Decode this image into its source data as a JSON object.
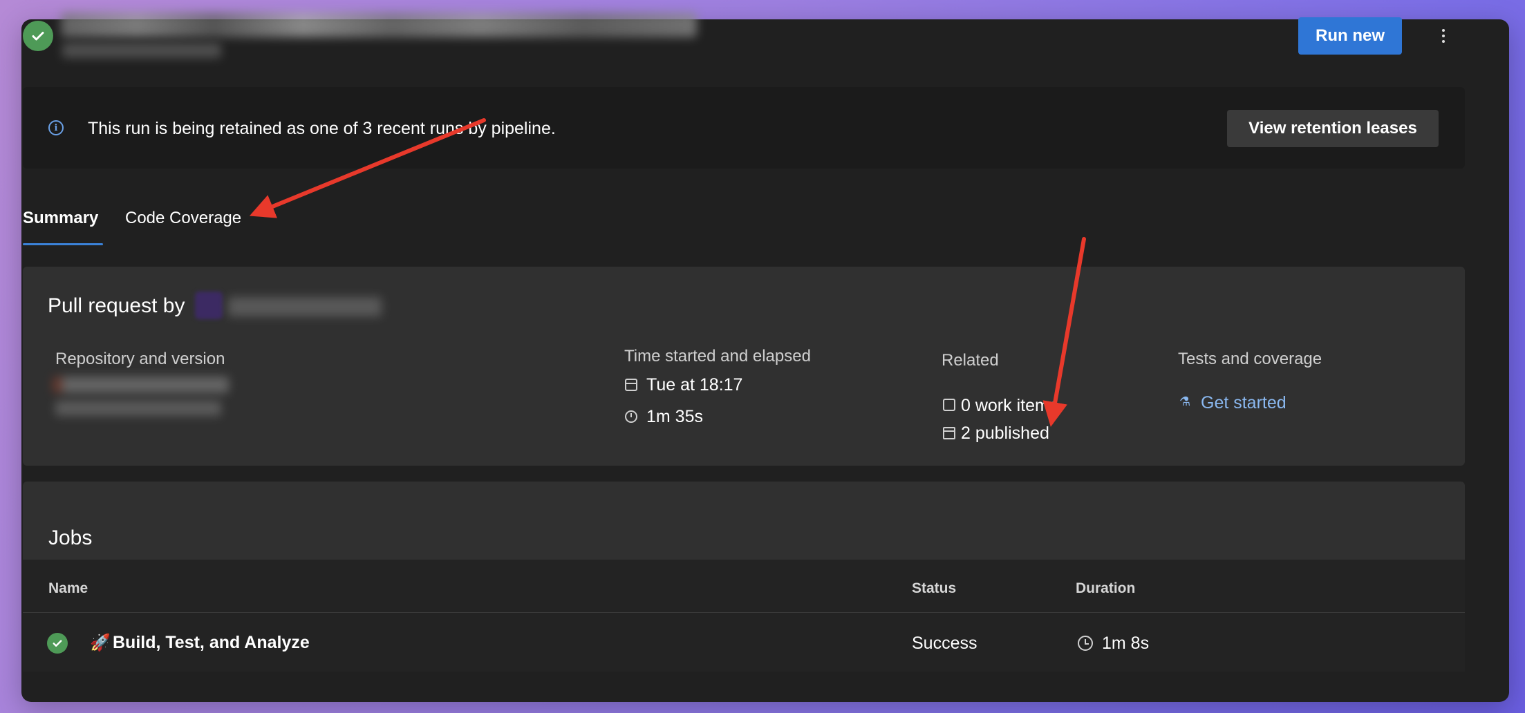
{
  "header": {
    "run_new_label": "Run new",
    "more_icon": "more-vertical-icon",
    "status_icon": "check-circle-icon"
  },
  "banner": {
    "icon": "info-icon",
    "text": "This run is being retained as one of 3 recent runs by pipeline.",
    "button_label": "View retention leases"
  },
  "tabs": [
    {
      "label": "Summary",
      "selected": true
    },
    {
      "label": "Code Coverage",
      "selected": false
    }
  ],
  "summary": {
    "title": "Pull request by",
    "repo_label": "Repository and version",
    "time_label": "Time started and elapsed",
    "time_started": "Tue at 18:17",
    "elapsed": "1m 35s",
    "related_label": "Related",
    "work_items": "0 work items",
    "published": "2 published",
    "tests_label": "Tests and coverage",
    "tests_link": "Get started"
  },
  "jobs": {
    "title": "Jobs",
    "columns": [
      "Name",
      "Status",
      "Duration"
    ],
    "rows": [
      {
        "emoji": "🚀",
        "name": "Build, Test, and Analyze",
        "status": "Success",
        "duration": "1m 8s"
      }
    ]
  },
  "colors": {
    "accent": "#2f76d6",
    "success": "#4e9a57",
    "link": "#8ab8f0",
    "annotation_arrow": "#e8392b"
  }
}
